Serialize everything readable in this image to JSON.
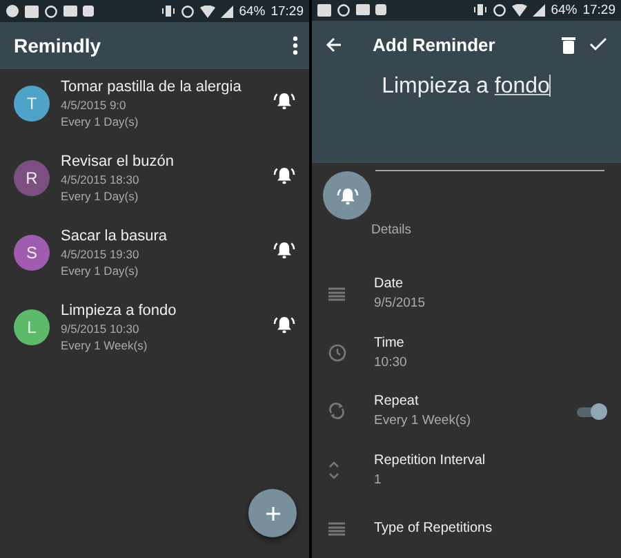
{
  "screens": [
    {
      "status_bar": {
        "battery": "64%",
        "time": "17:29"
      },
      "app_bar": {
        "title": "Remindly"
      },
      "reminders": [
        {
          "initial": "T",
          "color": "#4fa3c8",
          "title": "Tomar pastilla de la alergia",
          "date": "4/5/2015 9:0",
          "repeat": "Every 1 Day(s)",
          "alarm_on": true
        },
        {
          "initial": "R",
          "color": "#7b4f80",
          "title": "Revisar el buzón",
          "date": "4/5/2015 18:30",
          "repeat": "Every 1 Day(s)",
          "alarm_on": true
        },
        {
          "initial": "S",
          "color": "#a05cb0",
          "title": "Sacar la basura",
          "date": "4/5/2015 19:30",
          "repeat": "Every 1 Day(s)",
          "alarm_on": true
        },
        {
          "initial": "L",
          "color": "#5cba6a",
          "title": "Limpieza a fondo",
          "date": "9/5/2015 10:30",
          "repeat": "Every 1 Week(s)",
          "alarm_on": true
        }
      ]
    },
    {
      "status_bar": {
        "battery": "64%",
        "time": "17:29"
      },
      "toolbar": {
        "title": "Add Reminder"
      },
      "title_field": {
        "value": "Limpieza a fondo"
      },
      "section": "Details",
      "fields": [
        {
          "kind": "date",
          "label": "Date",
          "value": "9/5/2015"
        },
        {
          "kind": "time",
          "label": "Time",
          "value": "10:30"
        },
        {
          "kind": "repeat",
          "label": "Repeat",
          "value": "Every 1 Week(s)",
          "switch_on": true
        },
        {
          "kind": "interval",
          "label": "Repetition Interval",
          "value": "1"
        },
        {
          "kind": "type",
          "label": "Type of Repetitions"
        }
      ]
    }
  ]
}
